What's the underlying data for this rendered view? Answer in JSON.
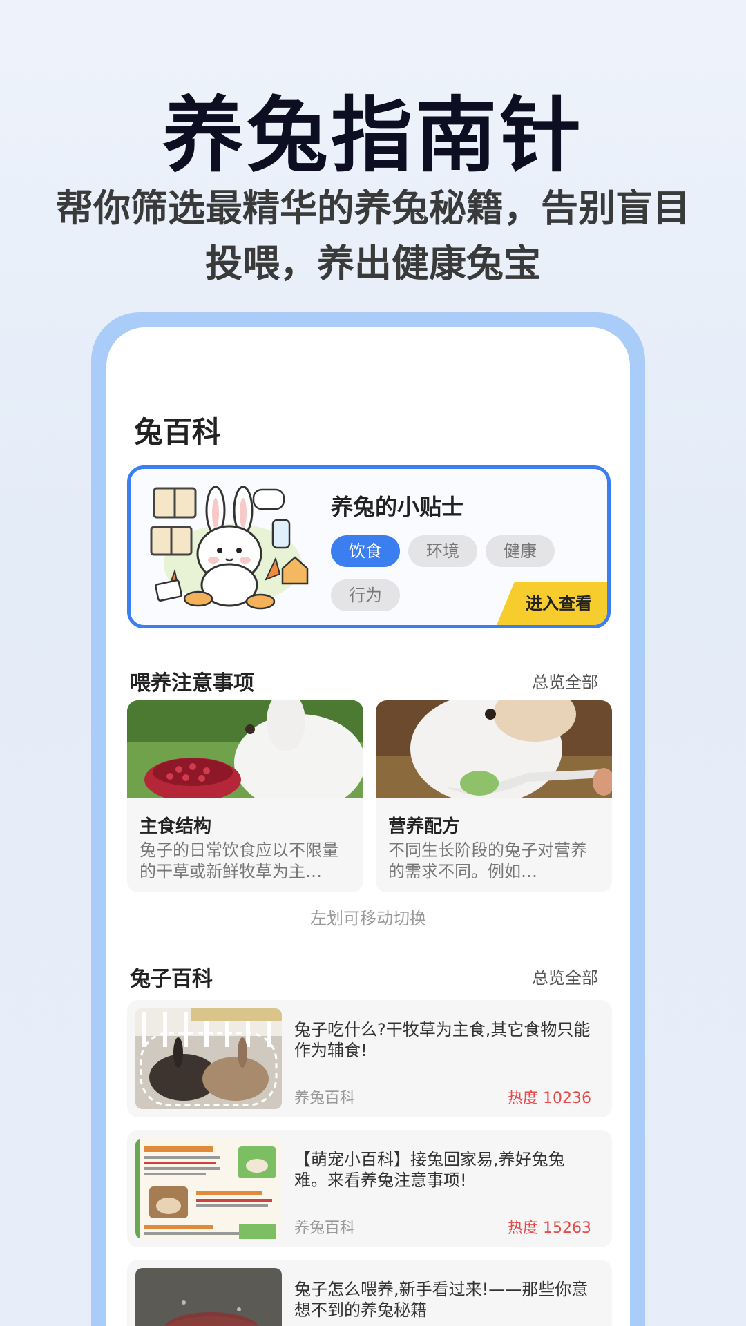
{
  "promo": {
    "title": "养兔指南针",
    "subtitle": "帮你筛选最精华的养兔秘籍，告别盲目投喂，养出健康兔宝"
  },
  "page": {
    "heading": "兔百科"
  },
  "tips_card": {
    "title": "养兔的小贴士",
    "tags": [
      "饮食",
      "环境",
      "健康",
      "行为"
    ],
    "active_tag": "饮食",
    "enter_label": "进入查看"
  },
  "care_section": {
    "title": "喂养注意事项",
    "see_all": "总览全部",
    "cards": [
      {
        "title": "主食结构",
        "desc": "兔子的日常饮食应以不限量的干草或新鲜牧草为主…"
      },
      {
        "title": "营养配方",
        "desc": "不同生长阶段的兔子对营养的需求不同。例如…"
      }
    ],
    "swipe_hint": "左划可移动切换"
  },
  "wiki_section": {
    "title": "兔子百科",
    "see_all": "总览全部",
    "articles": [
      {
        "title": "兔子吃什么?干牧草为主食,其它食物只能作为辅食!",
        "source": "养兔百科",
        "heat": "热度 10236"
      },
      {
        "title": "【萌宠小百科】接兔回家易,养好兔兔难。来看养兔注意事项!",
        "source": "养兔百科",
        "heat": "热度 15263"
      },
      {
        "title": "兔子怎么喂养,新手看过来!——那些你意想不到的养兔秘籍",
        "source": "",
        "heat": ""
      }
    ]
  },
  "colors": {
    "accent": "#3b7ef0",
    "button": "#f7cd2e",
    "heat": "#e84a4a",
    "frame": "#a9ccf8"
  }
}
